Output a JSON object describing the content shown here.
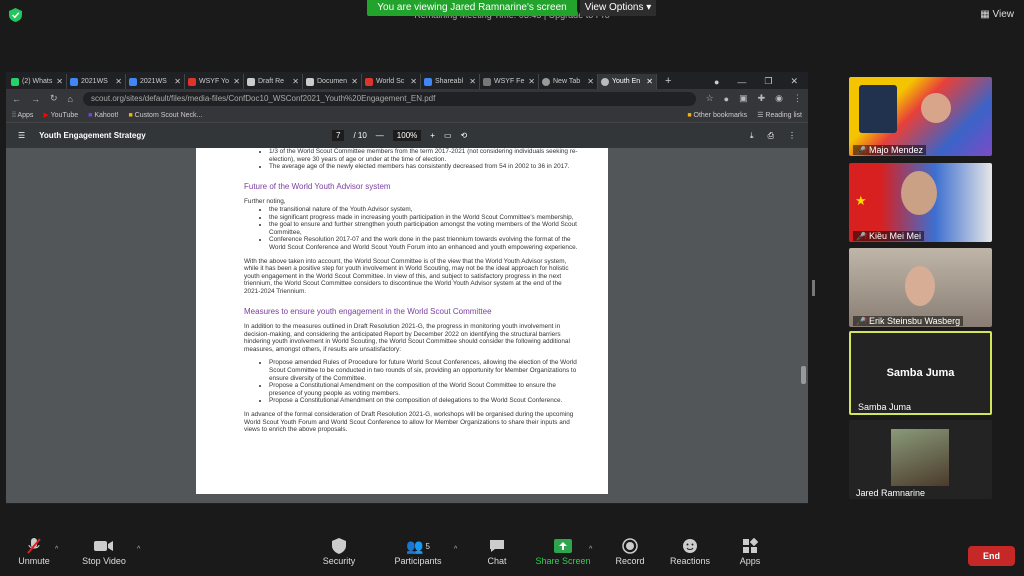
{
  "banner": {
    "text": "You are viewing Jared Ramnarine's screen",
    "view_options": "View Options ▾",
    "remaining": "Remaining Meeting Time: 03:45 | Upgrade to Pro"
  },
  "view_button": "View",
  "browser": {
    "tabs": [
      "(2) Whats",
      "2021WS",
      "2021WS",
      "WSYF Yo",
      "Draft Re",
      "Documen",
      "World Sc",
      "Shareabl",
      "WSYF Fe",
      "New Tab",
      "Youth En"
    ],
    "url": "scout.org/sites/default/files/media-files/ConfDoc10_WSConf2021_Youth%20Engagement_EN.pdf",
    "bookmarks": [
      "Apps",
      "YouTube",
      "Kahoot!",
      "Custom Scout Neck..."
    ],
    "other_bookmarks": "Other bookmarks",
    "reading_list": "Reading list"
  },
  "pdf": {
    "title": "Youth Engagement Strategy",
    "page": "7",
    "total": "/ 10",
    "zoom": "100%",
    "top_bullets": [
      "1/3 of the World Scout Committee members from the term 2017-2021 (not considering individuals seeking re-election), were 30 years of age or under at the time of election.",
      "The average age of the newly elected members has consistently decreased from 54 in 2002 to 36 in 2017."
    ],
    "heading1": "Future of the World Youth Advisor system",
    "further": "Further noting,",
    "bullets2": [
      "the transitional nature of the Youth Advisor system,",
      "the significant progress made in increasing youth participation in the World Scout Committee's membership,",
      "the goal to ensure and further strengthen youth participation amongst the voting members of the World Scout Committee,",
      "Conference Resolution 2017-07 and the work done in the past triennium towards evolving the format of the World Scout Conference and World Scout Youth Forum into an enhanced and youth empowering experience."
    ],
    "para1": "With the above taken into account, the World Scout Committee is of the view that the World Youth Advisor system, while it has been a positive step for youth involvement in World Scouting, may not be the ideal approach for holistic youth engagement in the World Scout Committee. In view of this, and subject to satisfactory progress in the next triennium, the World Scout Committee considers to discontinue the World Youth Advisor system at the end of the 2021-2024 Triennium.",
    "heading2": "Measures to ensure youth engagement in the World Scout Committee",
    "para2": "In addition to the measures outlined in Draft Resolution 2021-G, the progress in monitoring youth involvement in decision-making, and considering the anticipated Report by December 2022 on identifying the structural barriers hindering youth involvement in World Scouting, the World Scout Committee should consider the following additional measures, amongst others, if results are unsatisfactory:",
    "bullets3": [
      "Propose amended Rules of Procedure for future World Scout Conferences, allowing the election of the World Scout Committee to be conducted in two rounds of six, providing an opportunity for Member Organizations to ensure diversity of the Committee.",
      "Propose a Constitutional Amendment on the composition of the World Scout Committee to ensure the presence of young people as voting members.",
      "Propose a Constitutional Amendment on the composition of delegations to the World Scout Conference."
    ],
    "para3": "In advance of the formal consideration of Draft Resolution 2021-G, workshops will be organised during the upcoming World Scout Youth Forum and World Scout Conference to allow for Member Organizations to share their inputs and views to enrich the above proposals."
  },
  "participants": [
    {
      "name": "Majo Mendez"
    },
    {
      "name": "Kiều Mei Mei"
    },
    {
      "name": "Erik Steinsbu Wasberg"
    },
    {
      "name": "Samba Juma",
      "big": "Samba Juma"
    },
    {
      "name": "Jared Ramnarine"
    }
  ],
  "toolbar": {
    "unmute": "Unmute",
    "stop_video": "Stop Video",
    "security": "Security",
    "participants": "Participants",
    "participants_count": "5",
    "chat": "Chat",
    "share": "Share Screen",
    "record": "Record",
    "reactions": "Reactions",
    "apps": "Apps",
    "end": "End"
  }
}
